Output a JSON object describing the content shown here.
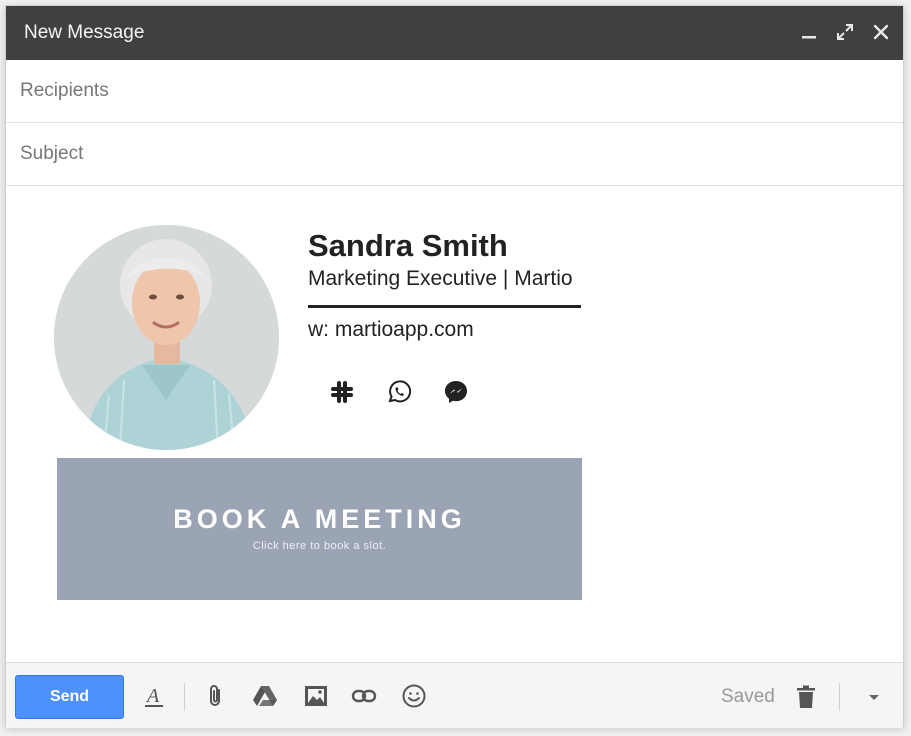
{
  "window": {
    "title": "New Message",
    "controls": [
      "minimize-icon",
      "expand-icon",
      "close-icon"
    ]
  },
  "fields": {
    "recipients_placeholder": "Recipients",
    "subject_placeholder": "Subject"
  },
  "signature": {
    "name": "Sandra Smith",
    "role": "Marketing Executive | Martio",
    "website": "w: martioapp.com",
    "social_icons": [
      "slack-icon",
      "whatsapp-icon",
      "messenger-icon"
    ],
    "banner": {
      "title": "BOOK A MEETING",
      "subtitle": "Click here to book a slot.",
      "color": "#9ba4b4"
    }
  },
  "toolbar": {
    "send_label": "Send",
    "send_color": "#4d90fe",
    "icons": [
      "formatting-icon",
      "attach-icon",
      "drive-icon",
      "photo-icon",
      "link-icon",
      "emoji-icon"
    ],
    "status": "Saved",
    "trash_icon": "trash-icon",
    "more_icon": "chevron-down-icon"
  },
  "colors": {
    "titlebar": "#404040",
    "text": "#222222"
  }
}
